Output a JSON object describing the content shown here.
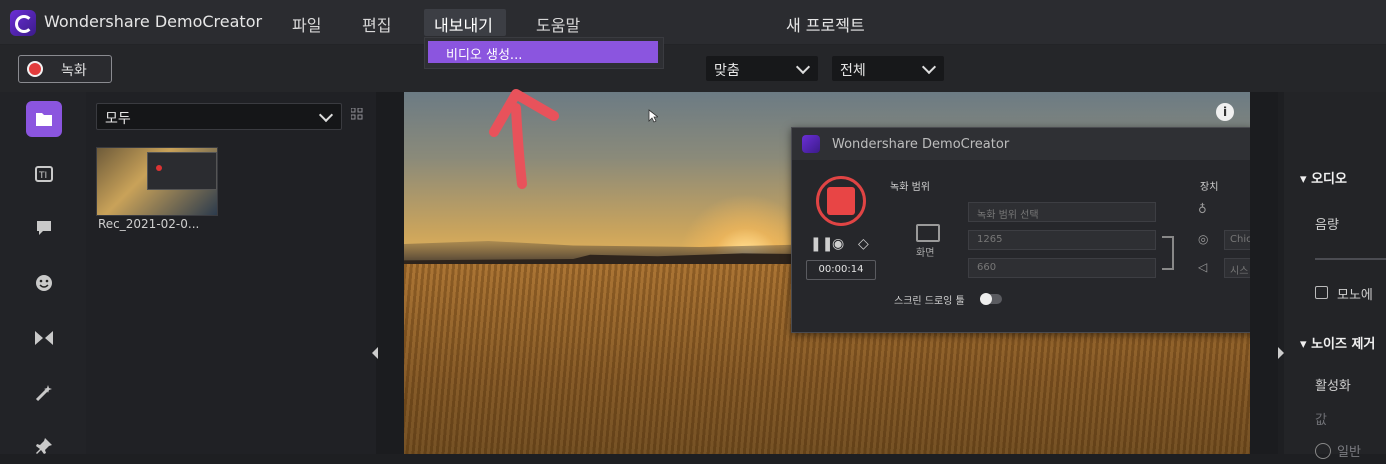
{
  "app": {
    "title": "Wondershare DemoCreator",
    "project_name": "새 프로젝트"
  },
  "menu": {
    "file": "파일",
    "edit": "편집",
    "export": "내보내기",
    "help": "도움말"
  },
  "export_menu": {
    "items": [
      {
        "label": "비디오 생성..."
      }
    ]
  },
  "toolbar": {
    "record_label": "녹화",
    "fit_select": "맞춤",
    "scope_select": "전체"
  },
  "media": {
    "filter": "모두",
    "items": [
      {
        "label": "Rec_2021-02-0..."
      }
    ]
  },
  "left_rail": {
    "icons": [
      "folder-icon",
      "text-icon",
      "caption-icon",
      "sticker-icon",
      "transition-icon",
      "effects-icon",
      "pin-icon"
    ]
  },
  "recorder": {
    "title": "Wondershare DemoCreator",
    "area_label": "녹화 범위",
    "screen_label": "화면",
    "area_select": "녹화 범위 선택",
    "width_value": "1265",
    "height_value": "660",
    "timer": "00:00:14",
    "audio_label": "장치",
    "side_field_1": "Chic",
    "side_field_2": "시스",
    "draw_tool_label": "스크린 드로잉 툴"
  },
  "right_panel": {
    "audio_section": "오디오",
    "volume_label": "음량",
    "mono_label": "모노에",
    "noise_section": "노이즈 제거",
    "enable_label": "활성화",
    "value_label": "값",
    "normal_label": "일반"
  },
  "colors": {
    "accent": "#8b55df",
    "record": "#e23c3c"
  }
}
